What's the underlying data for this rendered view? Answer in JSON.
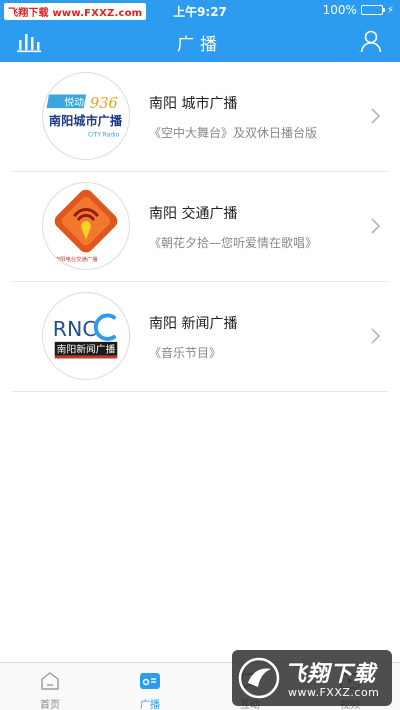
{
  "status_bar": {
    "watermark": "飞翔下载 www.FXXZ.com",
    "time": "上午9:27",
    "battery_percent": "100%",
    "battery_level": 1.0
  },
  "nav": {
    "title": "广播",
    "left_icon": "stats-bars-icon",
    "right_icon": "user-icon"
  },
  "stations": [
    {
      "name": "南阳 城市广播",
      "program": "《空中大舞台》及双休日播台版",
      "logo": {
        "top_text": "悦动",
        "freq": "936",
        "main_text": "南阳城市广播",
        "sub_text": "CITY Radio"
      }
    },
    {
      "name": "南阳 交通广播",
      "program": "《朝花夕拾—您听爱情在歌唱》",
      "logo": {
        "caption": "南阳电台交通广播"
      }
    },
    {
      "name": "南阳 新闻广播",
      "program": "《音乐节目》",
      "logo": {
        "letters": "RNC",
        "main_text": "南阳新闻广播"
      }
    }
  ],
  "tabs": [
    {
      "label": "首页",
      "icon": "home-icon",
      "active": false
    },
    {
      "label": "广播",
      "icon": "radio-icon",
      "active": true
    },
    {
      "label": "互动",
      "icon": "chat-icon",
      "active": false
    },
    {
      "label": "视频",
      "icon": "video-icon",
      "active": false
    }
  ],
  "watermark_bottom": {
    "title": "飞翔下载",
    "url": "www.FXXZ.com"
  },
  "colors": {
    "brand_blue": "#2d9bf0",
    "text_main": "#222222",
    "text_sub": "#888888",
    "divider": "#e6e6e6"
  }
}
